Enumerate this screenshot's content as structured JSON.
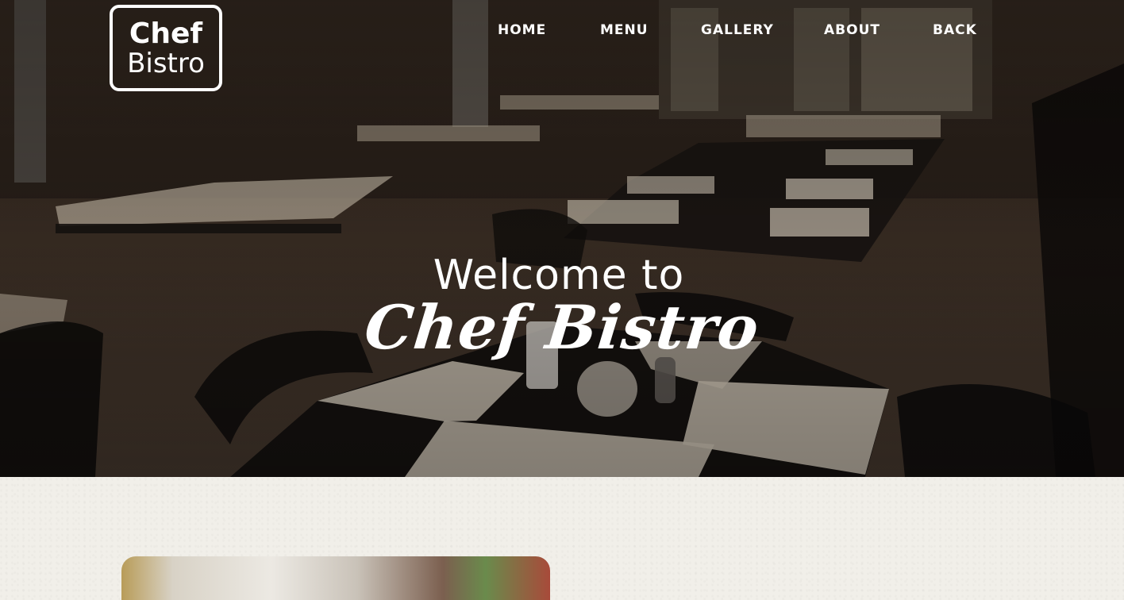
{
  "logo": {
    "line1": "Chef",
    "line2": "Bistro"
  },
  "nav": {
    "items": [
      {
        "label": "HOME"
      },
      {
        "label": "MENU"
      },
      {
        "label": "GALLERY"
      },
      {
        "label": "ABOUT"
      },
      {
        "label": "BACK"
      }
    ]
  },
  "hero": {
    "welcome": "Welcome to",
    "brand": "Chef Bistro",
    "background": "restaurant-interior-photo"
  },
  "colors": {
    "nav_text": "#ffffff",
    "section_background": "#f1efe9"
  },
  "section": {
    "image": "food-photo"
  }
}
